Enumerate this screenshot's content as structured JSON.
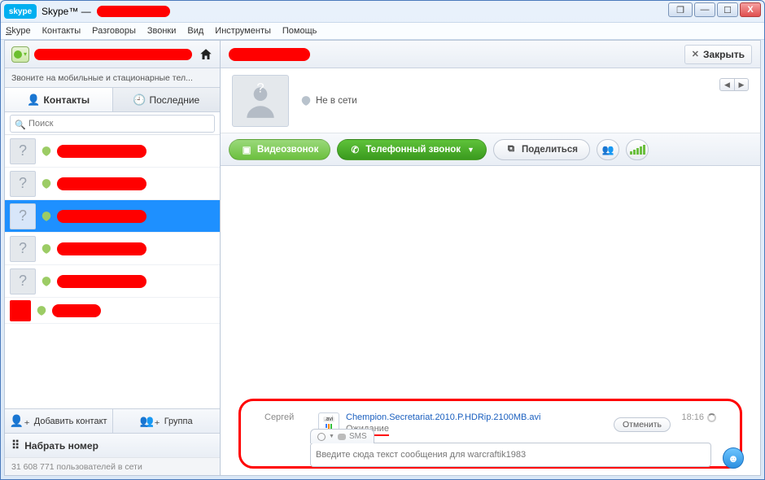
{
  "window": {
    "app_name": "Skype™",
    "logo_text": "skype"
  },
  "menubar": {
    "skype": "Skype",
    "contacts": "Контакты",
    "conversations": "Разговоры",
    "calls": "Звонки",
    "view": "Вид",
    "tools": "Инструменты",
    "help": "Помощь"
  },
  "sidebar": {
    "promo": "Звоните на мобильные и стационарные тел...",
    "tabs": {
      "contacts": "Контакты",
      "recent": "Последние"
    },
    "search_placeholder": "Поиск",
    "footer_buttons": {
      "add_contact": "Добавить контакт",
      "group": "Группа"
    },
    "dialpad": "Набрать номер",
    "online_users": "31 608 771 пользователей в сети"
  },
  "conversation": {
    "close": "Закрыть",
    "status": "Не в сети",
    "toolbar": {
      "video_call": "Видеозвонок",
      "phone_call": "Телефонный звонок",
      "share": "Поделиться"
    },
    "file_transfer": {
      "sender": "Сергей",
      "filename": "Chempion.Secretariat.2010.P.HDRip.2100MB.avi",
      "ext_label": ".avi",
      "status": "Ожидание",
      "cancel": "Отменить",
      "time": "18:16"
    },
    "input": {
      "sms_label": "SMS",
      "placeholder": "Введите сюда текст сообщения для warcraftik1983"
    }
  }
}
